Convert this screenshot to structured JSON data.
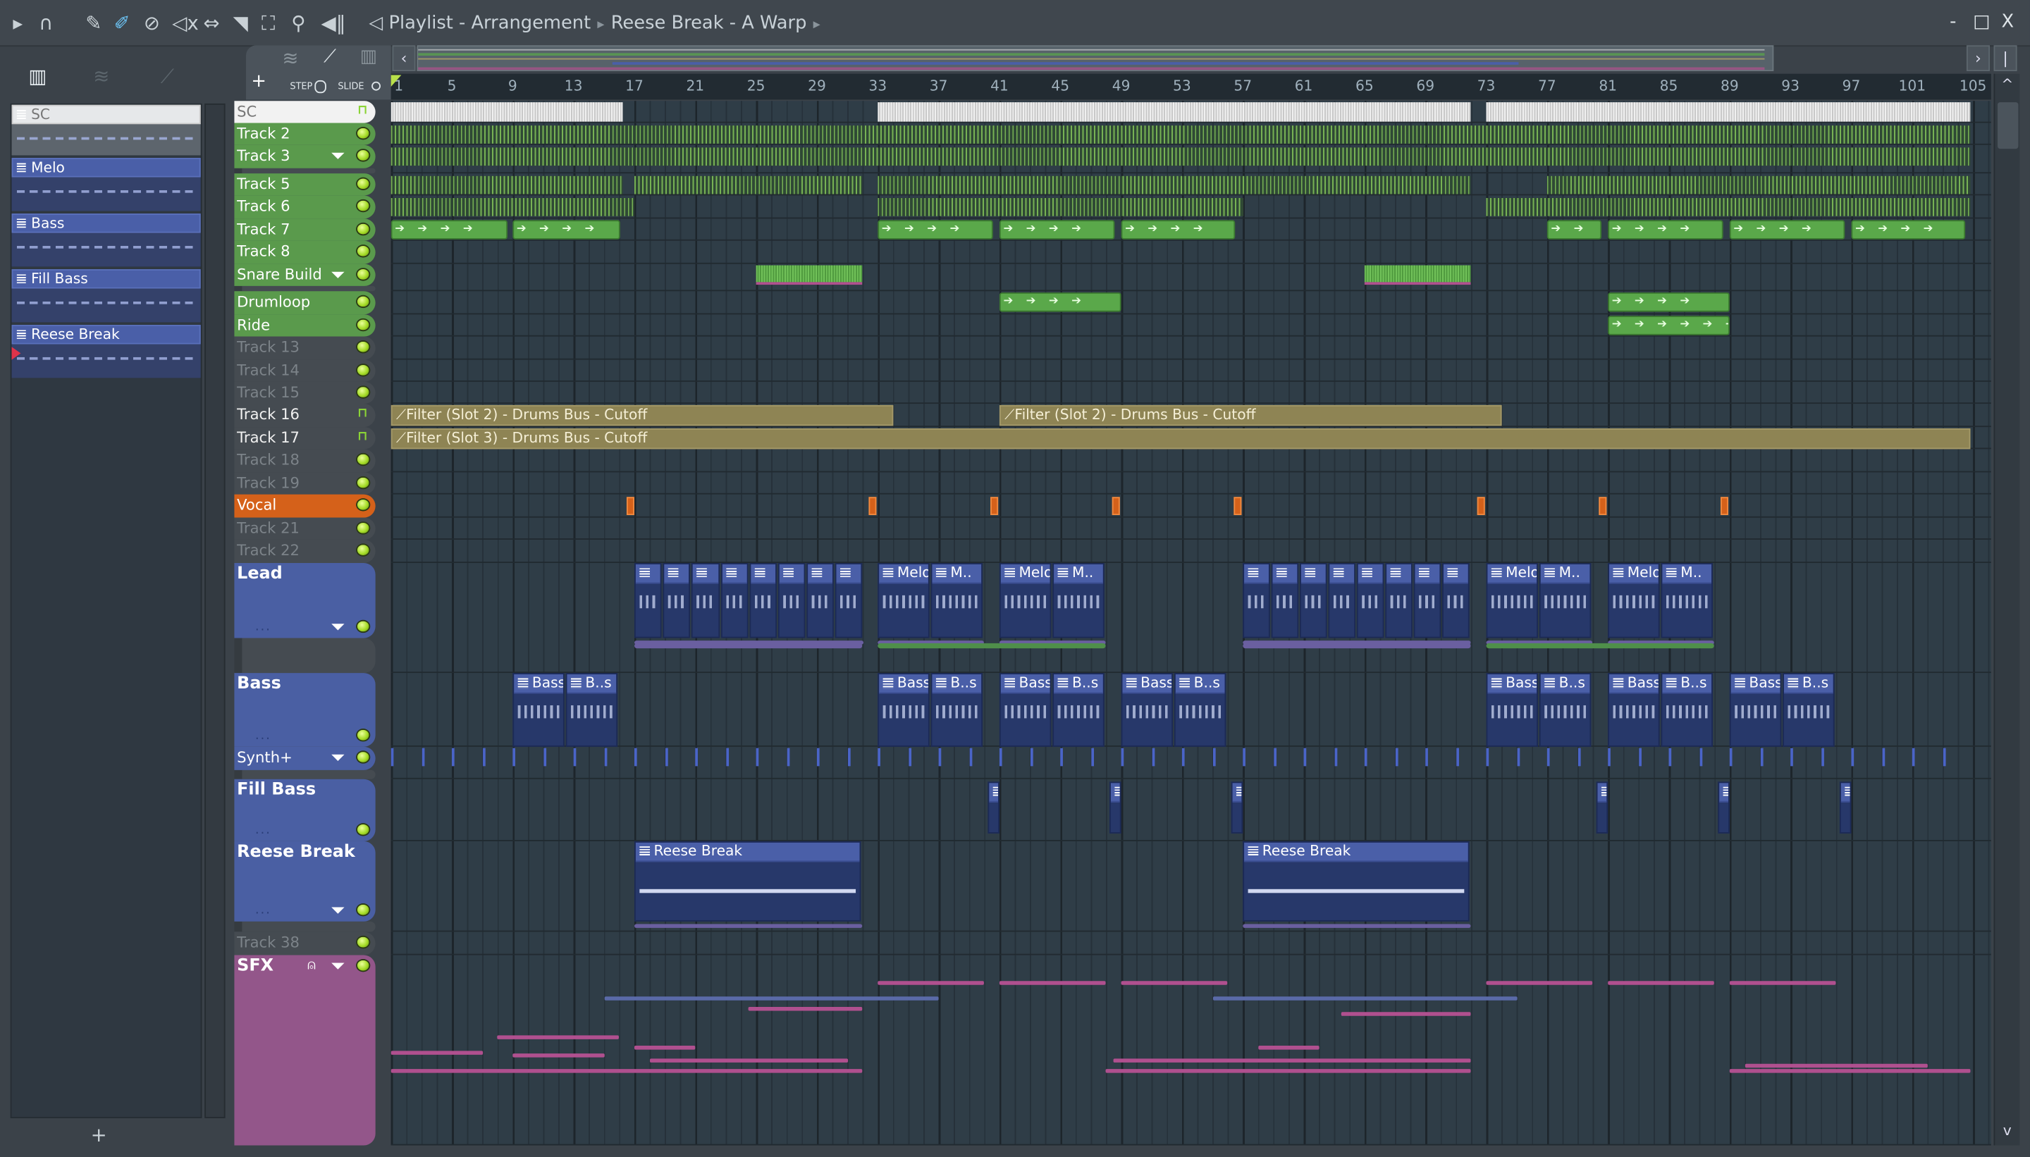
{
  "toolbar": {
    "icons": [
      "play-arrow-icon",
      "magnet-icon",
      "pencil-icon",
      "paint-brush-icon",
      "delete-icon",
      "mute-icon",
      "slip-icon",
      "slice-icon",
      "select-icon",
      "zoom-icon",
      "playback-icon"
    ],
    "title_part1": "Playlist - Arrangement",
    "title_part2": "Reese Break - A Warp"
  },
  "window": {
    "minimize": "-",
    "maximize": "□",
    "close": "X"
  },
  "tools": {
    "add": "+",
    "step": "STEP",
    "slide": "SLIDE"
  },
  "picker": {
    "items": [
      {
        "name": "SC",
        "kind": "audio"
      },
      {
        "name": "Melo",
        "kind": "pattern"
      },
      {
        "name": "Bass",
        "kind": "pattern"
      },
      {
        "name": "Fill Bass",
        "kind": "pattern"
      },
      {
        "name": "Reese Break",
        "kind": "pattern"
      }
    ],
    "add": "+"
  },
  "ruler": {
    "labels": [
      "1",
      "5",
      "9",
      "13",
      "17",
      "21",
      "25",
      "29",
      "33",
      "37",
      "41",
      "45",
      "49",
      "53",
      "57",
      "61",
      "65",
      "69",
      "73",
      "77",
      "81",
      "85",
      "89",
      "93",
      "97",
      "101",
      "105"
    ]
  },
  "colors": {
    "green": "#5a9a4c",
    "gray": "#454b51",
    "orange": "#d5611a",
    "blue": "#4a5fa3",
    "pink": "#93568a",
    "white": "#f2f2f2"
  },
  "tracks": [
    {
      "name": "SC",
      "color": "white",
      "icon": "lock"
    },
    {
      "name": "Track 2",
      "color": "green",
      "icon": "led"
    },
    {
      "name": "Track 3",
      "color": "green",
      "icon": "led",
      "dropdown": true
    },
    {
      "name": "Track 5",
      "color": "green",
      "icon": "led"
    },
    {
      "name": "Track 6",
      "color": "green",
      "icon": "led"
    },
    {
      "name": "Track 7",
      "color": "green",
      "icon": "led"
    },
    {
      "name": "Track 8",
      "color": "green",
      "icon": "led"
    },
    {
      "name": "Snare Build",
      "color": "green",
      "icon": "led",
      "dropdown": true
    },
    {
      "name": "Drumloop",
      "color": "green",
      "icon": "led"
    },
    {
      "name": "Ride",
      "color": "green",
      "icon": "led"
    },
    {
      "name": "Track 13",
      "color": "gray",
      "icon": "led",
      "dim": true
    },
    {
      "name": "Track 14",
      "color": "gray",
      "icon": "led",
      "dim": true
    },
    {
      "name": "Track 15",
      "color": "gray",
      "icon": "led",
      "dim": true
    },
    {
      "name": "Track 16",
      "color": "gray",
      "icon": "lock"
    },
    {
      "name": "Track 17",
      "color": "gray",
      "icon": "lock"
    },
    {
      "name": "Track 18",
      "color": "gray",
      "icon": "led",
      "dim": true
    },
    {
      "name": "Track 19",
      "color": "gray",
      "icon": "led",
      "dim": true
    },
    {
      "name": "Vocal",
      "color": "orange",
      "icon": "led"
    },
    {
      "name": "Track 21",
      "color": "gray",
      "icon": "led",
      "dim": true
    },
    {
      "name": "Track 22",
      "color": "gray",
      "icon": "led",
      "dim": true
    },
    {
      "name": "Lead",
      "color": "blue",
      "icon": "led",
      "dropdown": true,
      "dots": "..."
    },
    {
      "name": "Bass",
      "color": "blue",
      "icon": "led",
      "dots": "..."
    },
    {
      "name": "Synth+",
      "color": "blue",
      "icon": "led",
      "dropdown": true
    },
    {
      "name": "Fill Bass",
      "color": "blue",
      "icon": "led",
      "dots": "..."
    },
    {
      "name": "Reese Break",
      "color": "blue",
      "icon": "led",
      "dropdown": true,
      "dots": "..."
    },
    {
      "name": "Track 38",
      "color": "gray",
      "icon": "led",
      "dim": true
    },
    {
      "name": "SFX",
      "color": "pink",
      "icon": "led",
      "dropdown": true,
      "mic": true
    }
  ],
  "clips": [
    {
      "track": 0,
      "type": "white",
      "start": 1,
      "end": 16.2
    },
    {
      "track": 0,
      "type": "white",
      "start": 33,
      "end": 72
    },
    {
      "track": 0,
      "type": "white",
      "start": 73,
      "end": 104.8
    },
    {
      "track": 1,
      "type": "green",
      "start": 1,
      "end": 104.8
    },
    {
      "track": 2,
      "type": "green",
      "start": 1,
      "end": 104.8
    },
    {
      "track": 3,
      "type": "green",
      "start": 1,
      "end": 16.2
    },
    {
      "track": 3,
      "type": "green",
      "start": 17,
      "end": 32
    },
    {
      "track": 3,
      "type": "green",
      "start": 33,
      "end": 72
    },
    {
      "track": 3,
      "type": "green",
      "start": 77,
      "end": 104.8
    },
    {
      "track": 4,
      "type": "green",
      "start": 1,
      "end": 17
    },
    {
      "track": 4,
      "type": "green",
      "start": 33,
      "end": 57
    },
    {
      "track": 4,
      "type": "green",
      "start": 73,
      "end": 104.8
    },
    {
      "track": 5,
      "type": "audio",
      "start": 1,
      "end": 8.7,
      "label": "➔➔➔➔"
    },
    {
      "track": 5,
      "type": "audio",
      "start": 9,
      "end": 16.1,
      "label": "➔➔➔➔"
    },
    {
      "track": 5,
      "type": "audio",
      "start": 33,
      "end": 40.6,
      "label": "➔➔➔➔"
    },
    {
      "track": 5,
      "type": "audio",
      "start": 41,
      "end": 48.6,
      "label": "➔➔➔➔"
    },
    {
      "track": 5,
      "type": "audio",
      "start": 49,
      "end": 56.5,
      "label": "➔➔➔➔"
    },
    {
      "track": 5,
      "type": "audio",
      "start": 77,
      "end": 80.6,
      "label": "➔➔"
    },
    {
      "track": 5,
      "type": "audio",
      "start": 81,
      "end": 88.6,
      "label": "➔➔➔➔"
    },
    {
      "track": 5,
      "type": "audio",
      "start": 89,
      "end": 96.6,
      "label": "➔➔➔➔"
    },
    {
      "track": 5,
      "type": "audio",
      "start": 97,
      "end": 104.5,
      "label": "➔➔➔➔"
    },
    {
      "track": 7,
      "type": "snare",
      "start": 25,
      "end": 32
    },
    {
      "track": 7,
      "type": "snare",
      "start": 65,
      "end": 72
    },
    {
      "track": 8,
      "type": "audio",
      "start": 41,
      "end": 49,
      "label": "➔➔➔➔"
    },
    {
      "track": 8,
      "type": "audio",
      "start": 81,
      "end": 89,
      "label": "➔➔➔➔"
    },
    {
      "track": 9,
      "type": "audio",
      "start": 81,
      "end": 89,
      "label": "➔➔➔➔➔➔➔➔"
    },
    {
      "track": 13,
      "type": "auto",
      "start": 1,
      "end": 34,
      "label": "⟋Filter (Slot 2) - Drums Bus - Cutoff"
    },
    {
      "track": 13,
      "type": "auto",
      "start": 41,
      "end": 74,
      "label": "⟋Filter (Slot 2) - Drums Bus - Cutoff"
    },
    {
      "track": 14,
      "type": "auto",
      "start": 1,
      "end": 104.8,
      "label": "⟋Filter (Slot 3) - Drums Bus - Cutoff"
    },
    {
      "track": 17,
      "type": "vocal",
      "start": 16.5,
      "end": 17
    },
    {
      "track": 17,
      "type": "vocal",
      "start": 32.4,
      "end": 32.9
    },
    {
      "track": 17,
      "type": "vocal",
      "start": 40.4,
      "end": 40.9
    },
    {
      "track": 17,
      "type": "vocal",
      "start": 48.4,
      "end": 48.9
    },
    {
      "track": 17,
      "type": "vocal",
      "start": 56.4,
      "end": 56.9
    },
    {
      "track": 17,
      "type": "vocal",
      "start": 72.4,
      "end": 72.9
    },
    {
      "track": 17,
      "type": "vocal",
      "start": 80.4,
      "end": 80.9
    },
    {
      "track": 17,
      "type": "vocal",
      "start": 88.4,
      "end": 88.9
    },
    {
      "track": 20,
      "type": "blue",
      "start": 17,
      "end": 32.1,
      "parts": [
        "",
        "",
        "",
        "",
        "",
        "",
        "",
        ""
      ]
    },
    {
      "track": 20,
      "type": "blue",
      "start": 33,
      "end": 40,
      "parts": [
        "Melo",
        "M.."
      ]
    },
    {
      "track": 20,
      "type": "blue",
      "start": 41,
      "end": 48,
      "parts": [
        "Melo",
        "M.."
      ]
    },
    {
      "track": 20,
      "type": "blue",
      "start": 57,
      "end": 72,
      "parts": [
        "",
        "",
        "",
        "",
        "",
        "",
        "",
        ""
      ]
    },
    {
      "track": 20,
      "type": "blue",
      "start": 73,
      "end": 80,
      "parts": [
        "Melo",
        "M.."
      ]
    },
    {
      "track": 20,
      "type": "blue",
      "start": 81,
      "end": 88,
      "parts": [
        "Melo",
        "M.."
      ]
    },
    {
      "track": 21,
      "type": "blue",
      "start": 9,
      "end": 16,
      "parts": [
        "Bass",
        "B..s"
      ]
    },
    {
      "track": 21,
      "type": "blue",
      "start": 33,
      "end": 40,
      "parts": [
        "Bass",
        "B..s"
      ]
    },
    {
      "track": 21,
      "type": "blue",
      "start": 41,
      "end": 48,
      "parts": [
        "Bass",
        "B..s"
      ]
    },
    {
      "track": 21,
      "type": "blue",
      "start": 49,
      "end": 56,
      "parts": [
        "Bass",
        "B..s"
      ]
    },
    {
      "track": 21,
      "type": "blue",
      "start": 73,
      "end": 80,
      "parts": [
        "Bass",
        "B..s"
      ]
    },
    {
      "track": 21,
      "type": "blue",
      "start": 81,
      "end": 88,
      "parts": [
        "Bass",
        "B..s"
      ]
    },
    {
      "track": 21,
      "type": "blue",
      "start": 89,
      "end": 96,
      "parts": [
        "Bass",
        "B..s"
      ]
    },
    {
      "track": 23,
      "type": "fill",
      "start": 40.2,
      "end": 41
    },
    {
      "track": 23,
      "type": "fill",
      "start": 48.2,
      "end": 49
    },
    {
      "track": 23,
      "type": "fill",
      "start": 56.2,
      "end": 57
    },
    {
      "track": 23,
      "type": "fill",
      "start": 80.2,
      "end": 81
    },
    {
      "track": 23,
      "type": "fill",
      "start": 88.2,
      "end": 89
    },
    {
      "track": 23,
      "type": "fill",
      "start": 96.2,
      "end": 97
    },
    {
      "track": 24,
      "type": "reese",
      "start": 17,
      "end": 32,
      "parts": [
        "Reese Break"
      ]
    },
    {
      "track": 24,
      "type": "reese",
      "start": 57,
      "end": 72,
      "parts": [
        "Reese Break"
      ]
    }
  ],
  "sfx": [
    {
      "start": 33,
      "end": 40
    },
    {
      "start": 41,
      "end": 48
    },
    {
      "start": 49,
      "end": 56
    },
    {
      "start": 73,
      "end": 80
    },
    {
      "start": 81,
      "end": 88
    },
    {
      "start": 89,
      "end": 96
    },
    {
      "start": 15,
      "end": 37
    },
    {
      "start": 55,
      "end": 75
    },
    {
      "start": 24.5,
      "end": 32
    },
    {
      "start": 63.5,
      "end": 72
    },
    {
      "start": 8,
      "end": 16
    },
    {
      "start": 17,
      "end": 21
    },
    {
      "start": 58,
      "end": 62
    },
    {
      "start": 1,
      "end": 7
    },
    {
      "start": 9,
      "end": 15
    },
    {
      "start": 18,
      "end": 31
    },
    {
      "start": 48.5,
      "end": 72
    },
    {
      "start": 90,
      "end": 102
    },
    {
      "start": 1,
      "end": 32
    },
    {
      "start": 48,
      "end": 72
    },
    {
      "start": 89,
      "end": 104.8
    }
  ]
}
